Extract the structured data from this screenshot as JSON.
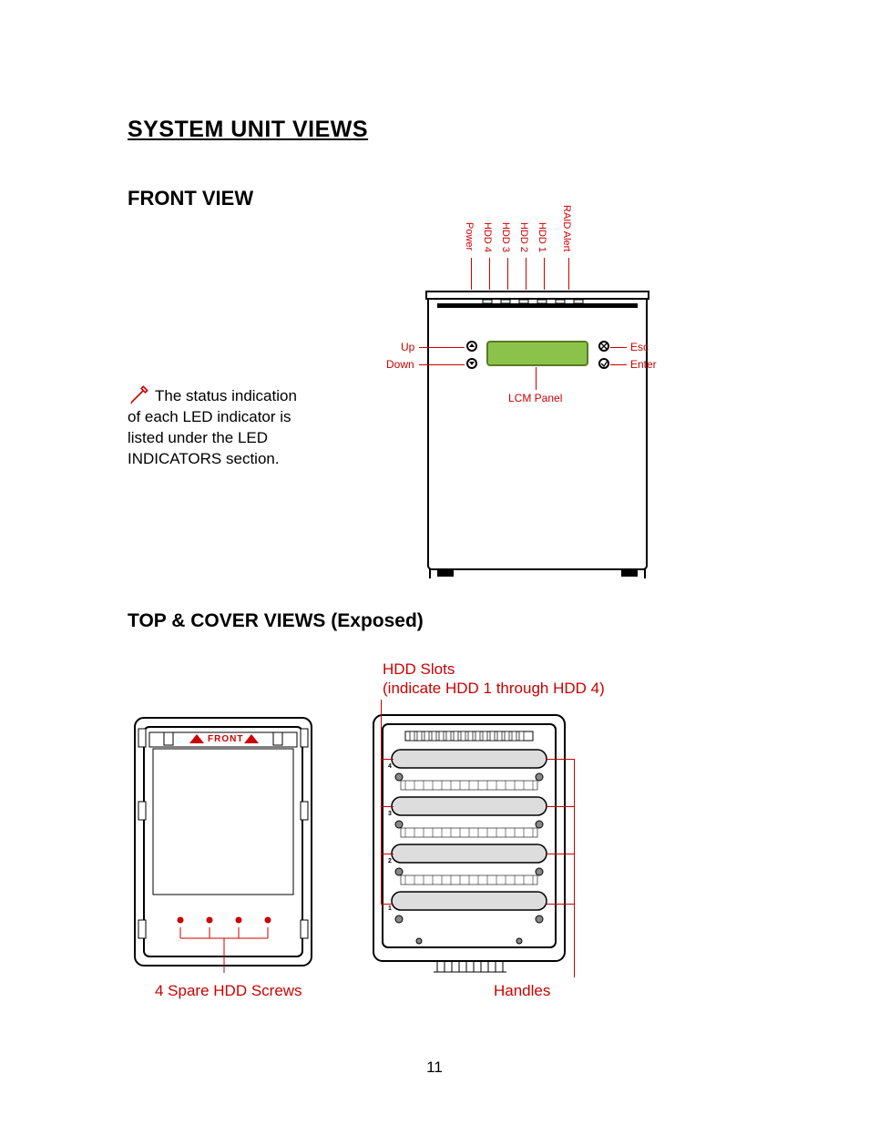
{
  "headings": {
    "main": "SYSTEM UNIT VIEWS",
    "front": "FRONT VIEW",
    "top": "TOP & COVER VIEWS (Exposed)"
  },
  "note_text": "The status indication of each LED indicator is listed under the LED INDICATORS section.",
  "front_view": {
    "led_labels": {
      "power": "Power",
      "hdd4": "HDD 4",
      "hdd3": "HDD 3",
      "hdd2": "HDD 2",
      "hdd1": "HDD 1",
      "raid": "RAID Alert"
    },
    "buttons": {
      "up": "Up",
      "down": "Down",
      "esc": "Esc",
      "enter": "Enter"
    },
    "lcm": "LCM Panel"
  },
  "top_cover": {
    "hdd_slots_line1": "HDD Slots",
    "hdd_slots_line2": "(indicate HDD 1 through HDD 4)",
    "screws": "4 Spare HDD Screws",
    "handles": "Handles",
    "front_tag": "FRONT"
  },
  "page_number": "11"
}
